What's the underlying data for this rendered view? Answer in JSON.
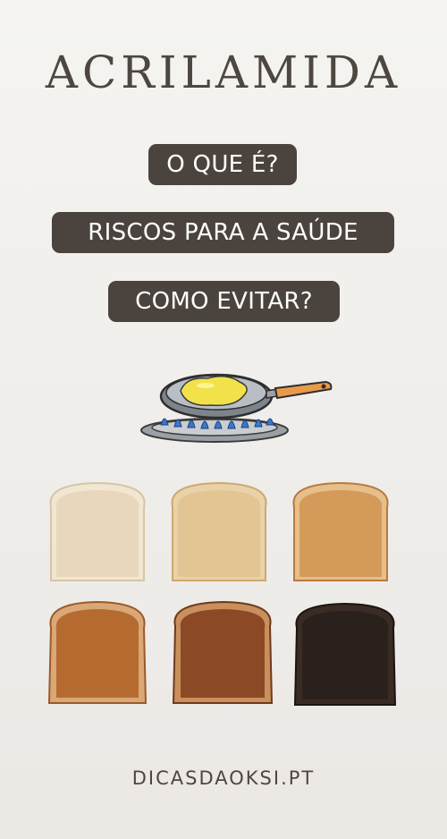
{
  "title": "ACRILAMIDA",
  "pills": [
    "O QUE É?",
    "RISCOS PARA A SAÚDE",
    "COMO EVITAR?"
  ],
  "illustration": {
    "icon": "frying-pan-on-gas-stove-icon",
    "colors": {
      "pan": "#b9bec4",
      "egg": "#f2e24a",
      "handle": "#e89a4a",
      "flame": "#3a78c9"
    }
  },
  "toasts": [
    {
      "level": 1,
      "color": "#e8d7bd"
    },
    {
      "level": 2,
      "color": "#e2c592"
    },
    {
      "level": 3,
      "color": "#d49a5a"
    },
    {
      "level": 4,
      "color": "#b56b30"
    },
    {
      "level": 5,
      "color": "#8b4a25"
    },
    {
      "level": 6,
      "color": "#2b211c"
    }
  ],
  "footer": "DICASDAOKSI.PT"
}
